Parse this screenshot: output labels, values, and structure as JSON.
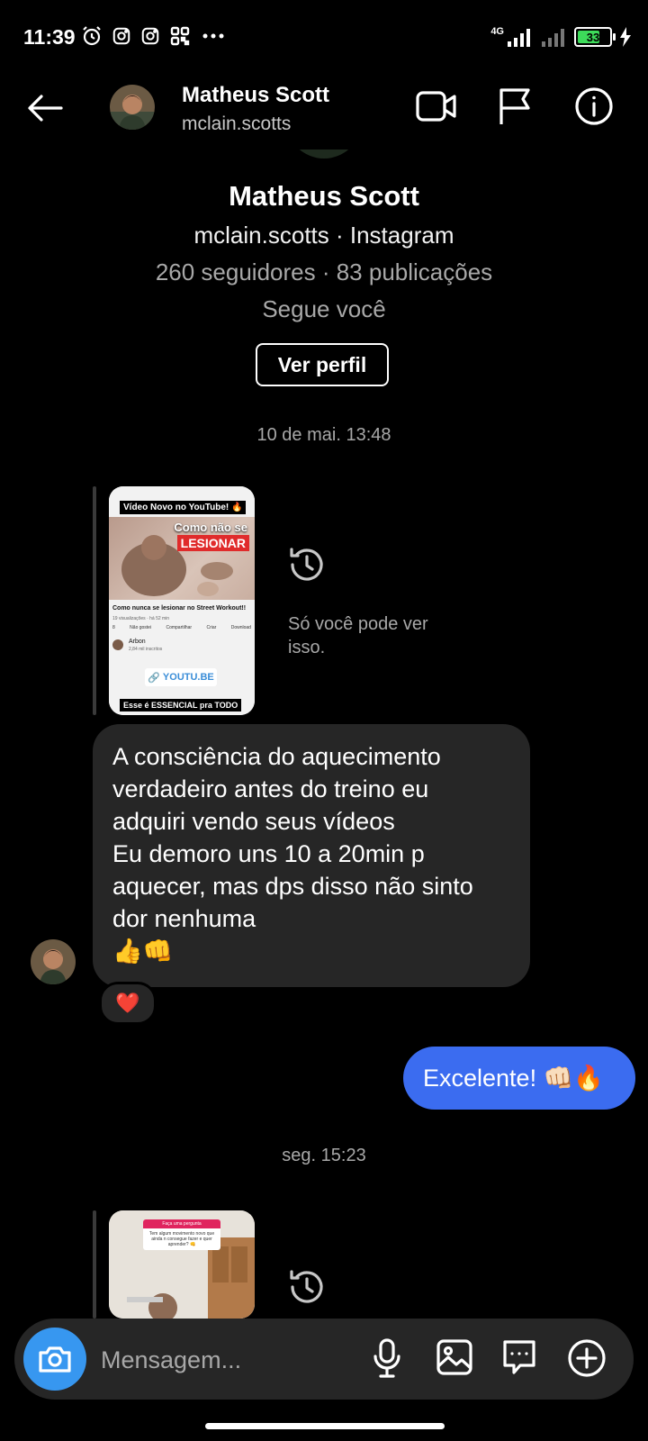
{
  "status_bar": {
    "time": "11:39",
    "network": "4G",
    "battery_level": "33"
  },
  "header": {
    "name": "Matheus Scott",
    "username": "mclain.scotts"
  },
  "profile": {
    "name": "Matheus Scott",
    "handle_line": "mclain.scotts · Instagram",
    "stats_line": "260 seguidores · 83 publicações",
    "follows_line": "Segue você",
    "view_profile_label": "Ver perfil"
  },
  "conversation": {
    "date_1": "10 de mai. 13:48",
    "story_1": {
      "top_banner": "Vídeo Novo no YouTube! 🔥",
      "overlay_line_1": "Como não se",
      "overlay_line_2": "LESIONAR",
      "video_title": "Como nunca se lesionar no Street Workout!!",
      "video_meta": "19 visualizações · há 52 min",
      "action_like": "8",
      "action_dislike": "Não gostei",
      "action_share": "Compartilhar",
      "action_create": "Criar",
      "action_download": "Download",
      "channel_name": "Arbon",
      "channel_subs": "2,84 mil inscritos",
      "link_label": "YOUTU.BE",
      "bottom_text": "Esse é ESSENCIAL pra TODO"
    },
    "only_you_text": "Só você pode ver isso.",
    "received_message_lines": [
      "A consciência do aquecimento",
      "verdadeiro antes do treino eu",
      "adquiri vendo seus vídeos",
      "Eu demoro uns 10 a 20min p",
      "aquecer, mas dps disso não sinto",
      "dor nenhuma",
      "👍👊"
    ],
    "reaction": "❤️",
    "sent_message": "Excelente! 👊🏻🔥",
    "date_2": "seg. 15:23",
    "story_2": {
      "question_header": "Faça uma pergunta",
      "question_text": "Tem algum movimento novo que ainda n consegue fazer e quer aprender? 👊"
    }
  },
  "composer": {
    "placeholder": "Mensagem..."
  },
  "icons": {
    "back": "arrow-left-icon",
    "video_call": "video-camera-icon",
    "report": "flag-icon",
    "info": "info-icon",
    "expired_story": "history-icon",
    "camera": "camera-icon",
    "mic": "microphone-icon",
    "gallery": "image-icon",
    "sticker": "chat-bubble-icon",
    "add": "plus-circle-icon"
  },
  "colors": {
    "background": "#000000",
    "received_bubble": "#262626",
    "sent_bubble": "#3b6cf0",
    "camera_button": "#3797f0"
  }
}
